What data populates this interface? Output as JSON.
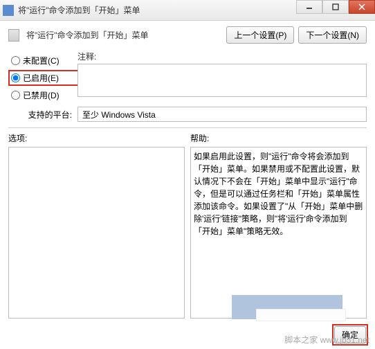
{
  "titlebar": {
    "title": "将\"运行\"命令添加到「开始」菜单"
  },
  "header": {
    "title": "将\"运行\"命令添加到「开始」菜单",
    "prev_btn": "上一个设置(P)",
    "next_btn": "下一个设置(N)"
  },
  "radios": {
    "not_configured": "未配置(C)",
    "enabled": "已启用(E)",
    "disabled": "已禁用(D)",
    "selected": "enabled"
  },
  "comment": {
    "label": "注释:",
    "value": ""
  },
  "platform": {
    "label": "支持的平台:",
    "value": "至少 Windows Vista"
  },
  "options": {
    "label": "选项:"
  },
  "help": {
    "label": "帮助:",
    "text": "如果启用此设置，则\"运行\"命令将会添加到「开始」菜单。如果禁用或不配置此设置，默认情况下不会在「开始」菜单中显示\"运行\"命令，但是可以通过任务栏和「开始」菜单属性添加该命令。如果设置了\"从「开始」菜单中删除'运行'链接\"策略，则\"将'运行'命令添加到「开始」菜单\"策略无效。"
  },
  "buttons": {
    "ok": "确定"
  },
  "watermark": "脚本之家 www.jb51.net"
}
